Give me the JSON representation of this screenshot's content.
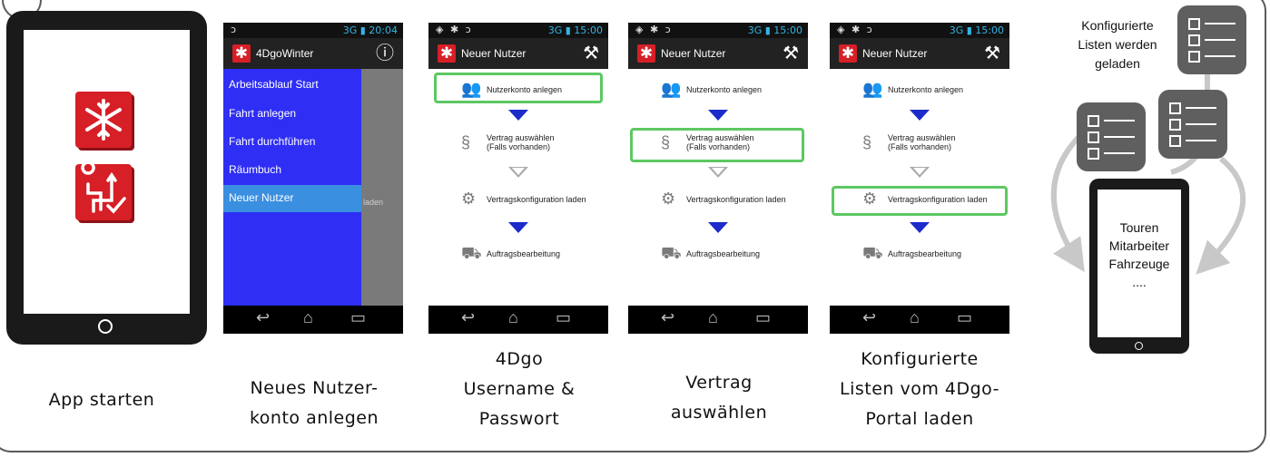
{
  "colors": {
    "accent_red": "#d61f26",
    "highlight_green": "#5dc862",
    "arrow_blue": "#1c2bc9",
    "drawer_blue": "#2e2ef5",
    "drawer_active": "#3b8fe0"
  },
  "step1": {
    "caption": "App starten"
  },
  "step2": {
    "statusbar_left": "ↄ",
    "statusbar_right": "3G ▮ 20:04",
    "app_title": "4DgoWinter",
    "drawer_items": [
      "Arbeitsablauf Start",
      "Fahrt anlegen",
      "Fahrt durchführen",
      "Räumbuch",
      "Neuer Nutzer"
    ],
    "background_hint": "laden",
    "caption_line1": "Neues Nutzer-",
    "caption_line2": "konto anlegen"
  },
  "screens": {
    "statusbar_left": "◈ ✱ ↄ",
    "statusbar_right": "3G ▮ 15:00",
    "title": "Neuer Nutzer",
    "steps": {
      "account": "Nutzerkonto anlegen",
      "contract_line1": "Vertrag auswählen",
      "contract_line2": "(Falls vorhanden)",
      "config": "Vertragskonfiguration laden",
      "orders": "Auftragsbearbeitung"
    }
  },
  "step3": {
    "caption_line1": "4Dgo",
    "caption_line2": "Username &",
    "caption_line3": "Passwort"
  },
  "step4": {
    "caption_line1": "Vertrag",
    "caption_line2": "auswählen"
  },
  "step5": {
    "caption_line1": "Konfigurierte",
    "caption_line2": "Listen vom 4Dgo-",
    "caption_line3": "Portal laden"
  },
  "diagram": {
    "note_line1": "Konfigurierte",
    "note_line2": "Listen werden",
    "note_line3": "geladen",
    "device_lines": [
      "Touren",
      "Mitarbeiter",
      "Fahrzeuge",
      "...."
    ]
  }
}
